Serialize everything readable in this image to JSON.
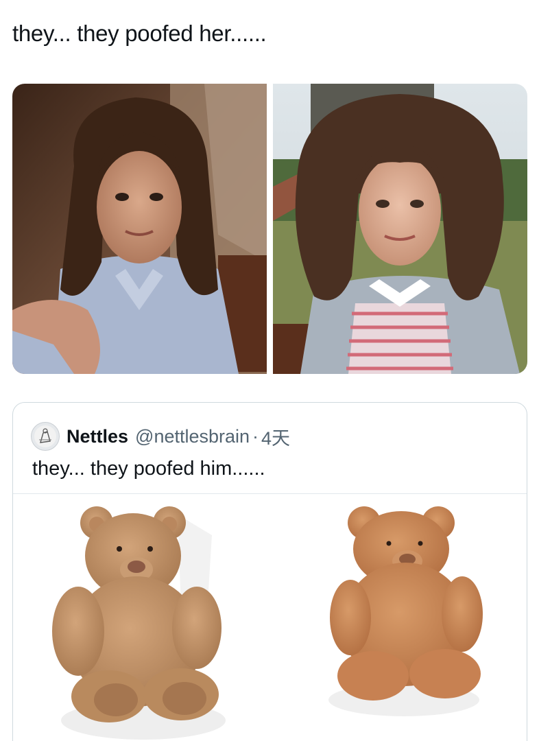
{
  "post": {
    "text": "they... they poofed her......"
  },
  "media": {
    "images": [
      {
        "name": "photo-dark-wavy-hair",
        "alt": ""
      },
      {
        "name": "photo-curly-hair-bangs",
        "alt": ""
      }
    ]
  },
  "quoted": {
    "display_name": "Nettles",
    "handle": "@nettlesbrain",
    "separator": "·",
    "time": "4天",
    "text": "they... they poofed him......",
    "avatar_icon": "avatar-icon"
  },
  "colors": {
    "text": "#0f1419",
    "secondary": "#536471",
    "border": "#cfd9de"
  }
}
